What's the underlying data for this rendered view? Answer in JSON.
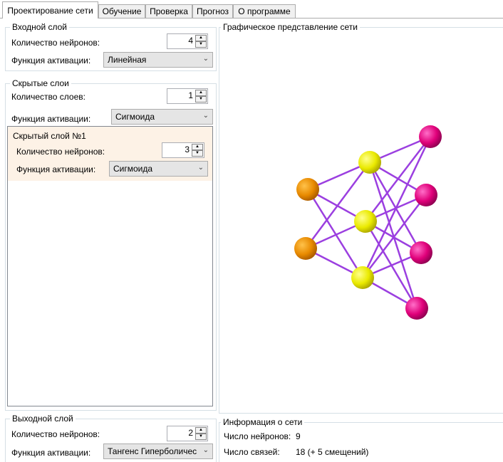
{
  "tabs": [
    {
      "label": "Проектирование сети"
    },
    {
      "label": "Обучение"
    },
    {
      "label": "Проверка"
    },
    {
      "label": "Прогноз"
    },
    {
      "label": "О программе"
    }
  ],
  "input_layer": {
    "title": "Входной слой",
    "neurons_label": "Количество нейронов:",
    "neurons_value": "4",
    "activation_label": "Функция активации:",
    "activation_value": "Линейная"
  },
  "hidden_layers": {
    "title": "Скрытые слои",
    "count_label": "Количество слоев:",
    "count_value": "1",
    "activation_label": "Функция активации:",
    "activation_value": "Сигмоида",
    "layer1": {
      "title": "Скрытый слой №1",
      "neurons_label": "Количество нейронов:",
      "neurons_value": "3",
      "activation_label": "Функция активации:",
      "activation_value": "Сигмоида"
    }
  },
  "output_layer": {
    "title": "Выходной слой",
    "neurons_label": "Количество нейронов:",
    "neurons_value": "2",
    "activation_label": "Функция активации:",
    "activation_value": "Тангенс Гиперболичес"
  },
  "graph": {
    "title": "Графическое представление сети",
    "colors": {
      "input": "#f08c00",
      "hidden": "#f2f200",
      "output": "#e6007e",
      "link": "#9b3fe0"
    }
  },
  "info": {
    "title": "Информация о сети",
    "neurons_label": "Число нейронов:",
    "neurons_value": "9",
    "links_label": "Число связей:",
    "links_value": "18 (+ 5 смещений)"
  }
}
